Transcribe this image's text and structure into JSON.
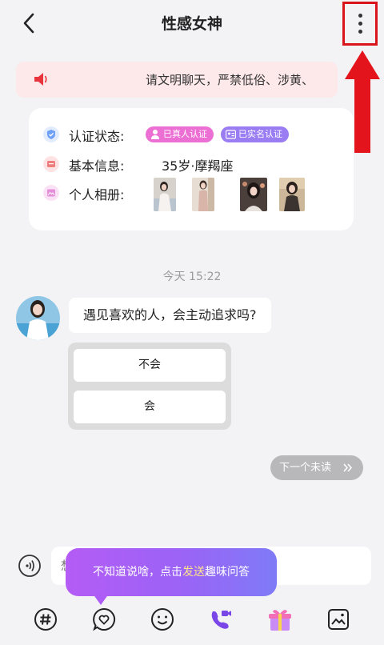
{
  "header": {
    "title": "性感女神",
    "back_icon": "chevron-left-icon",
    "more_icon": "more-vertical-icon",
    "annotation_color": "#d9141b"
  },
  "notice": {
    "text": "请文明聊天，严禁低俗、涉黄、",
    "icon": "speaker-icon",
    "background": "#fde8ea"
  },
  "profile": {
    "verify_label": "认证状态:",
    "badges": [
      {
        "label": "已真人认证",
        "color": "#ec6fd4",
        "icon": "person-verified-icon"
      },
      {
        "label": "已实名认证",
        "color": "#9a7df3",
        "icon": "id-card-icon"
      }
    ],
    "info_label": "基本信息:",
    "info_value": "35岁·摩羯座",
    "album_label": "个人相册:"
  },
  "chat": {
    "timestamp": "今天 15:22",
    "message": "遇见喜欢的人，会主动追求吗?",
    "options": [
      "不会",
      "会"
    ],
    "next_unread": "下一个未读",
    "next_unread_icon": "double-chevron-right-icon"
  },
  "input": {
    "placeholder": "想",
    "tooltip_prefix": "不知道说啥，点击",
    "tooltip_highlight": "发送",
    "tooltip_suffix": "趣味问答"
  },
  "toolbar": [
    "hashtag-icon",
    "heart-chat-icon",
    "smile-icon",
    "video-call-icon",
    "gift-icon",
    "image-icon"
  ]
}
